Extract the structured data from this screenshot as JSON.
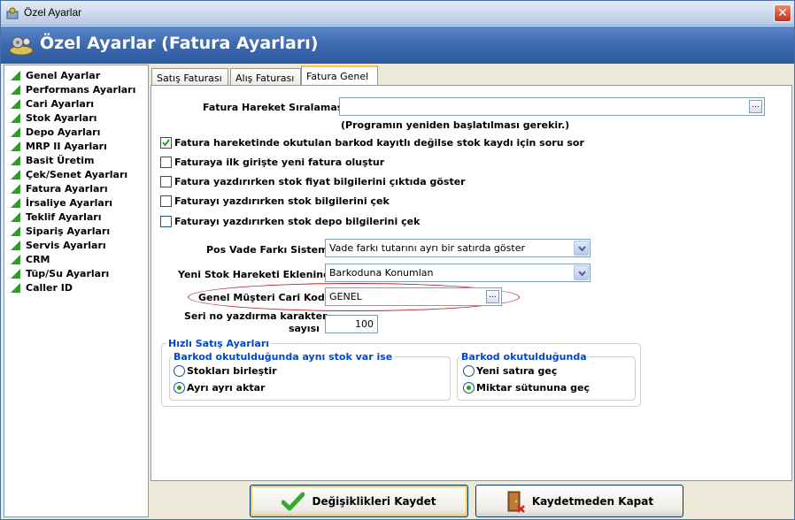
{
  "window": {
    "title": "Özel Ayarlar",
    "close_glyph": "✕"
  },
  "banner": {
    "title": "Özel Ayarlar (Fatura Ayarları)"
  },
  "sidebar": {
    "items": [
      {
        "label": "Genel Ayarlar"
      },
      {
        "label": "Performans Ayarları"
      },
      {
        "label": "Cari Ayarları"
      },
      {
        "label": "Stok Ayarları"
      },
      {
        "label": "Depo Ayarları"
      },
      {
        "label": "MRP II Ayarları"
      },
      {
        "label": "Basit Üretim"
      },
      {
        "label": "Çek/Senet Ayarları"
      },
      {
        "label": "Fatura Ayarları"
      },
      {
        "label": "İrsaliye Ayarları"
      },
      {
        "label": "Teklif Ayarları"
      },
      {
        "label": "Sipariş Ayarları"
      },
      {
        "label": "Servis Ayarları"
      },
      {
        "label": "CRM"
      },
      {
        "label": "Tüp/Su Ayarları"
      },
      {
        "label": "Caller ID"
      }
    ]
  },
  "tabs": [
    {
      "label": "Satış Faturası"
    },
    {
      "label": "Alış Faturası"
    },
    {
      "label": "Fatura Genel",
      "active": true
    }
  ],
  "form": {
    "siralama_label": "Fatura Hareket Sıralaması",
    "siralama_value": "",
    "restart_note": "(Programın yeniden başlatılması gerekir.)",
    "checkboxes": [
      {
        "label": "Fatura hareketinde okutulan barkod kayıtlı değilse stok kaydı için soru sor",
        "checked": true
      },
      {
        "label": "Faturaya ilk girişte yeni fatura oluştur",
        "checked": false
      },
      {
        "label": "Fatura yazdırırken stok fiyat bilgilerini çıktıda göster",
        "checked": false
      },
      {
        "label": "Faturayı yazdırırken stok bilgilerini çek",
        "checked": false
      },
      {
        "label": "Faturayı yazdırırken stok depo bilgilerini çek",
        "checked": false
      }
    ],
    "vade_label": "Pos Vade Farkı Sistemi",
    "vade_value": "Vade farkı tutarını ayrı bir satırda göster",
    "stok_label": "Yeni Stok Hareketi Eklenince",
    "stok_value": "Barkoduna Konumlan",
    "cari_label": "Genel Müşteri Cari Kodu",
    "cari_value": "GENEL",
    "seri_label_1": "Seri no yazdırma karakter",
    "seri_label_2": "sayısı",
    "seri_value": "100",
    "ellipsis": "..."
  },
  "hizli": {
    "title": "Hızlı Satış Ayarları",
    "group1": {
      "title": "Barkod okutulduğunda aynı stok var ise",
      "options": [
        {
          "label": "Stokları birleştir",
          "selected": false
        },
        {
          "label": "Ayrı ayrı aktar",
          "selected": true
        }
      ]
    },
    "group2": {
      "title": "Barkod okutulduğunda",
      "options": [
        {
          "label": "Yeni satıra geç",
          "selected": false
        },
        {
          "label": "Miktar sütununa geç",
          "selected": true
        }
      ]
    }
  },
  "footer": {
    "save_label": "Değişiklikleri Kaydet",
    "close_label": "Kaydetmeden Kapat"
  },
  "colors": {
    "banner": "#3c68b0",
    "group_title": "#0046d5",
    "highlight_ellipse": "#c0202a",
    "check_green": "#21a121"
  }
}
